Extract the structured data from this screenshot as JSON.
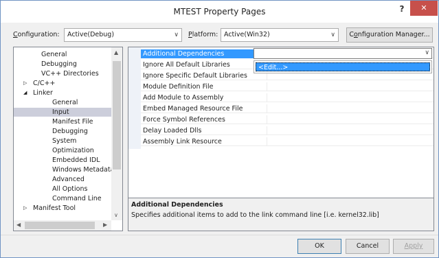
{
  "window": {
    "title": "MTEST Property Pages",
    "help_glyph": "?",
    "close_glyph": "✕"
  },
  "config_bar": {
    "configuration_label_prefix": "C",
    "configuration_label_rest": "onfiguration:",
    "configuration_value": "Active(Debug)",
    "platform_label_prefix": "P",
    "platform_label_rest": "latform:",
    "platform_value": "Active(Win32)",
    "manager_button_prefix": "C",
    "manager_button_u": "o",
    "manager_button_rest": "nfiguration Manager..."
  },
  "tree": {
    "items": [
      {
        "label": "General",
        "expander": ""
      },
      {
        "label": "Debugging",
        "expander": ""
      },
      {
        "label": "VC++ Directories",
        "expander": ""
      },
      {
        "label": "C/C++",
        "expander": "▷"
      },
      {
        "label": "Linker",
        "expander": "◢"
      },
      {
        "label": "General",
        "expander": ""
      },
      {
        "label": "Input",
        "expander": "",
        "selected": true
      },
      {
        "label": "Manifest File",
        "expander": ""
      },
      {
        "label": "Debugging",
        "expander": ""
      },
      {
        "label": "System",
        "expander": ""
      },
      {
        "label": "Optimization",
        "expander": ""
      },
      {
        "label": "Embedded IDL",
        "expander": ""
      },
      {
        "label": "Windows Metadata",
        "expander": ""
      },
      {
        "label": "Advanced",
        "expander": ""
      },
      {
        "label": "All Options",
        "expander": ""
      },
      {
        "label": "Command Line",
        "expander": ""
      },
      {
        "label": "Manifest Tool",
        "expander": "▷"
      }
    ]
  },
  "grid": {
    "properties": [
      {
        "name": "Additional Dependencies",
        "selected": true
      },
      {
        "name": "Ignore All Default Libraries"
      },
      {
        "name": "Ignore Specific Default Libraries"
      },
      {
        "name": "Module Definition File"
      },
      {
        "name": "Add Module to Assembly"
      },
      {
        "name": "Embed Managed Resource File"
      },
      {
        "name": "Force Symbol References"
      },
      {
        "name": "Delay Loaded Dlls"
      },
      {
        "name": "Assembly Link Resource"
      }
    ],
    "edit_option": "<Edit...>"
  },
  "description": {
    "title": "Additional Dependencies",
    "text": "Specifies additional items to add to the link command line [i.e. kernel32.lib]"
  },
  "buttons": {
    "ok": "OK",
    "cancel": "Cancel",
    "apply": "Apply"
  },
  "icons": {
    "dropdown": "chevron-down-icon",
    "scroll_up": "arrow-up-icon",
    "scroll_down": "arrow-down-icon",
    "scroll_left": "arrow-left-icon",
    "scroll_right": "arrow-right-icon"
  },
  "colors": {
    "selection": "#3399ff",
    "tree_selection": "#cccedb",
    "close_button": "#c7504b"
  }
}
